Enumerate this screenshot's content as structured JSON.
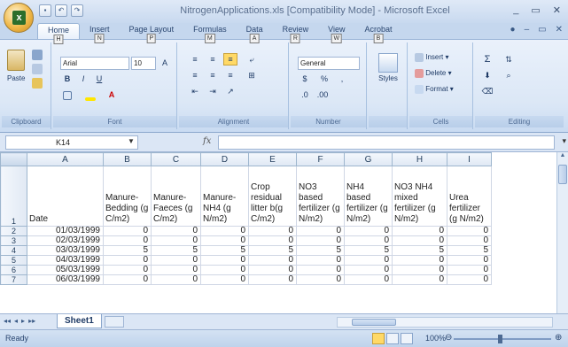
{
  "window": {
    "title": "NitrogenApplications.xls  [Compatibility Mode] - Microsoft Excel",
    "controls": [
      "_",
      "▭",
      "✕"
    ]
  },
  "ribbon_tabs": [
    {
      "label": "Home",
      "keytip": "H",
      "active": true
    },
    {
      "label": "Insert",
      "keytip": "N"
    },
    {
      "label": "Page Layout",
      "keytip": "P"
    },
    {
      "label": "Formulas",
      "keytip": "M"
    },
    {
      "label": "Data",
      "keytip": "A"
    },
    {
      "label": "Review",
      "keytip": "R"
    },
    {
      "label": "View",
      "keytip": "W"
    },
    {
      "label": "Acrobat",
      "keytip": "B"
    }
  ],
  "ribbon": {
    "clipboard": {
      "label": "Clipboard",
      "paste": "Paste"
    },
    "font": {
      "label": "Font",
      "name": "Arial",
      "size": "10"
    },
    "alignment": {
      "label": "Alignment"
    },
    "number": {
      "label": "Number",
      "format": "General"
    },
    "styles": {
      "label": "Styles"
    },
    "cells": {
      "label": "Cells",
      "insert": "Insert",
      "delete": "Delete",
      "format": "Format"
    },
    "editing": {
      "label": "Editing"
    }
  },
  "formula_bar": {
    "name_box": "K14",
    "fx": "fx",
    "formula": ""
  },
  "grid": {
    "columns": [
      "A",
      "B",
      "C",
      "D",
      "E",
      "F",
      "G",
      "H",
      "I"
    ],
    "header_row_number": "1",
    "headers": [
      "Date",
      "Manure-Bedding (g C/m2)",
      "Manure-Faeces (g C/m2)",
      "Manure-NH4 (g N/m2)",
      "Crop residual litter b(g C/m2)",
      "NO3 based fertilizer (g N/m2)",
      "NH4 based fertilizer (g N/m2)",
      "NO3 NH4 mixed fertilizer (g N/m2)",
      "Urea fertilizer (g N/m2)"
    ],
    "rows": [
      {
        "n": "2",
        "date": "01/03/1999",
        "values": [
          "0",
          "0",
          "0",
          "0",
          "0",
          "0",
          "0",
          "0"
        ]
      },
      {
        "n": "3",
        "date": "02/03/1999",
        "values": [
          "0",
          "0",
          "0",
          "0",
          "0",
          "0",
          "0",
          "0"
        ]
      },
      {
        "n": "4",
        "date": "03/03/1999",
        "values": [
          "5",
          "5",
          "5",
          "5",
          "5",
          "5",
          "5",
          "5"
        ]
      },
      {
        "n": "5",
        "date": "04/03/1999",
        "values": [
          "0",
          "0",
          "0",
          "0",
          "0",
          "0",
          "0",
          "0"
        ]
      },
      {
        "n": "6",
        "date": "05/03/1999",
        "values": [
          "0",
          "0",
          "0",
          "0",
          "0",
          "0",
          "0",
          "0"
        ]
      },
      {
        "n": "7",
        "date": "06/03/1999",
        "values": [
          "0",
          "0",
          "0",
          "0",
          "0",
          "0",
          "0",
          "0"
        ]
      }
    ]
  },
  "sheets": {
    "active": "Sheet1"
  },
  "status": {
    "text": "Ready",
    "zoom": "100%"
  }
}
